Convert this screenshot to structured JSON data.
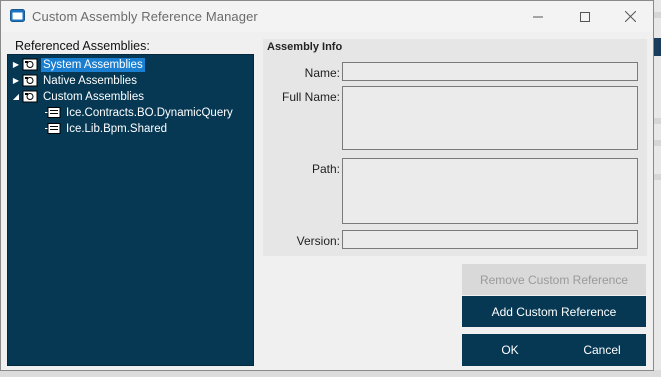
{
  "window": {
    "title": "Custom Assembly Reference Manager",
    "controls": {
      "minimize": "—",
      "maximize": "☐",
      "close": "✕"
    }
  },
  "references_label": "Referenced Assemblies:",
  "tree": {
    "nodes": [
      {
        "label": "System Assemblies",
        "expanded": false,
        "selected": true
      },
      {
        "label": "Native Assemblies",
        "expanded": false,
        "selected": false
      },
      {
        "label": "Custom Assemblies",
        "expanded": true,
        "selected": false,
        "children": [
          {
            "label": "Ice.Contracts.BO.DynamicQuery"
          },
          {
            "label": "Ice.Lib.Bpm.Shared"
          }
        ]
      }
    ]
  },
  "assembly_info": {
    "title": "Assembly Info",
    "name_label": "Name:",
    "fullname_label": "Full Name:",
    "path_label": "Path:",
    "version_label": "Version:",
    "name_value": "",
    "fullname_value": "",
    "path_value": "",
    "version_value": ""
  },
  "buttons": {
    "remove": "Remove Custom Reference",
    "add": "Add Custom Reference",
    "ok": "OK",
    "cancel": "Cancel"
  },
  "colors": {
    "tree_bg": "#063854",
    "primary_button": "#063854",
    "selection": "#1b7fd1"
  }
}
